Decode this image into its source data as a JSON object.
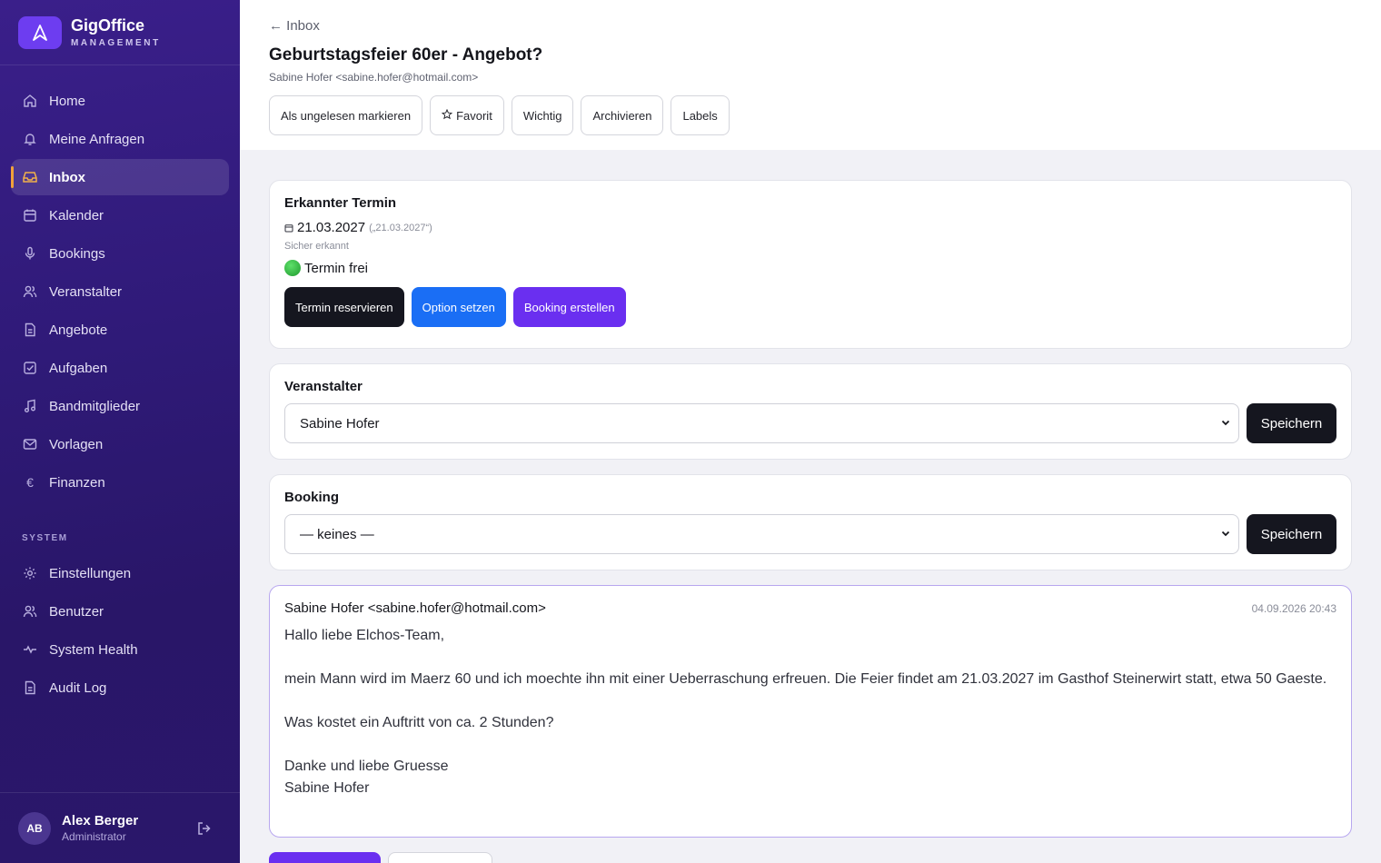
{
  "brand": {
    "name": "GigOffice",
    "subtitle": "MANAGEMENT"
  },
  "nav": {
    "items": [
      {
        "label": "Home",
        "icon": "home-icon"
      },
      {
        "label": "Meine Anfragen",
        "icon": "bell-icon"
      },
      {
        "label": "Inbox",
        "icon": "inbox-icon",
        "active": true
      },
      {
        "label": "Kalender",
        "icon": "calendar-icon"
      },
      {
        "label": "Bookings",
        "icon": "microphone-icon"
      },
      {
        "label": "Veranstalter",
        "icon": "users-icon"
      },
      {
        "label": "Angebote",
        "icon": "document-icon"
      },
      {
        "label": "Aufgaben",
        "icon": "checkbox-icon"
      },
      {
        "label": "Bandmitglieder",
        "icon": "music-icon"
      },
      {
        "label": "Vorlagen",
        "icon": "mail-icon"
      },
      {
        "label": "Finanzen",
        "icon": "euro-icon"
      }
    ],
    "system_label": "SYSTEM",
    "system_items": [
      {
        "label": "Einstellungen",
        "icon": "gear-icon"
      },
      {
        "label": "Benutzer",
        "icon": "users-icon"
      },
      {
        "label": "System Health",
        "icon": "pulse-icon"
      },
      {
        "label": "Audit Log",
        "icon": "document-icon"
      }
    ]
  },
  "user": {
    "initials": "AB",
    "name": "Alex Berger",
    "role": "Administrator"
  },
  "header": {
    "back_label": "← Inbox",
    "title": "Geburtstagsfeier 60er - Angebot?",
    "from": "Sabine Hofer <sabine.hofer@hotmail.com>",
    "actions": {
      "mark_unread": "Als ungelesen markieren",
      "favorite": "Favorit",
      "important": "Wichtig",
      "archive": "Archivieren",
      "labels": "Labels"
    }
  },
  "detected": {
    "title": "Erkannter Termin",
    "date": "21.03.2027",
    "raw": "(„21.03.2027“)",
    "confidence": "Sicher erkannt",
    "status": "Termin frei",
    "status_color": "#22a832",
    "buttons": {
      "reserve": "Termin reservieren",
      "option": "Option setzen",
      "booking": "Booking erstellen"
    }
  },
  "organizer": {
    "title": "Veranstalter",
    "selected": "Sabine Hofer",
    "save": "Speichern"
  },
  "booking": {
    "title": "Booking",
    "selected": "— keines —",
    "save": "Speichern"
  },
  "message": {
    "from": "Sabine Hofer <sabine.hofer@hotmail.com>",
    "date": "04.09.2026 20:43",
    "greeting": "Hallo liebe Elchos-Team,",
    "para1": "mein Mann wird im Maerz 60 und ich moechte ihn mit einer Ueberraschung erfreuen. Die Feier findet am 21.03.2027 im Gasthof Steinerwirt statt, etwa 50 Gaeste.",
    "para2": "Was kostet ein Auftritt von ca. 2 Stunden?",
    "closing": "Danke und liebe Gruesse",
    "signature": "Sabine Hofer"
  },
  "colors": {
    "sidebar": "#2f1a78",
    "accent_purple": "#6a2ff0",
    "accent_blue": "#1a6ef5",
    "active_marker": "#f2a23a"
  }
}
